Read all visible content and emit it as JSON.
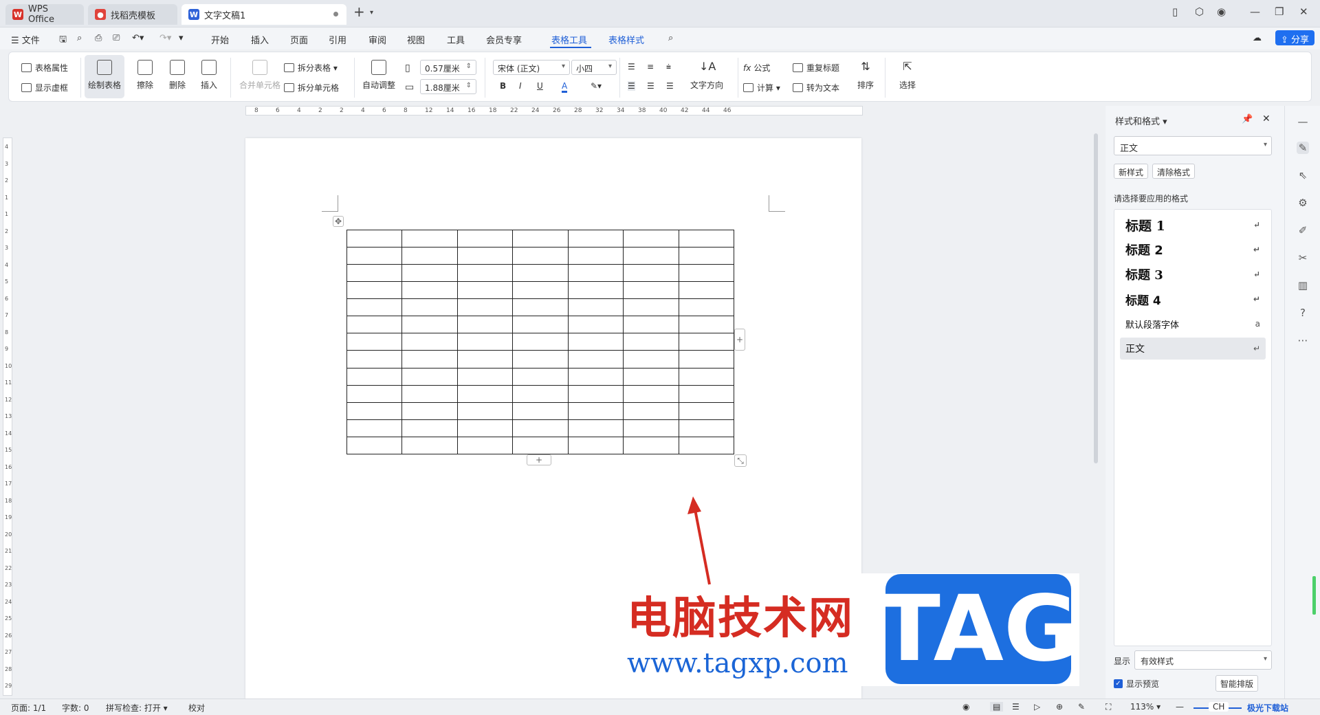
{
  "tabs": [
    {
      "label": "WPS Office",
      "icon": "wps-logo-icon"
    },
    {
      "label": "找稻壳模板",
      "icon": "docer-icon"
    },
    {
      "label": "文字文稿1",
      "icon": "writer-doc-icon"
    }
  ],
  "new_tab": "+",
  "menu": {
    "file": "文件",
    "items": [
      "开始",
      "插入",
      "页面",
      "引用",
      "审阅",
      "视图",
      "工具",
      "会员专享",
      "表格工具",
      "表格样式"
    ],
    "active": "表格工具",
    "share": "分享"
  },
  "ribbon": {
    "table_props": "表格属性",
    "show_gridlines": "显示虚框",
    "draw_table": "绘制表格",
    "erase": "擦除",
    "delete": "删除",
    "insert": "插入",
    "merge_cells": "合并单元格",
    "split_table": "拆分表格",
    "split_cells": "拆分单元格",
    "auto_fit": "自动调整",
    "col_width": "0.57厘米",
    "row_height": "1.88厘米",
    "font_name": "宋体 (正文)",
    "font_size": "小四",
    "bold": "B",
    "italic": "I",
    "underline": "U",
    "font_color": "A",
    "text_direction": "文字方向",
    "formula": "公式",
    "calculate": "计算",
    "repeat_header": "重复标题",
    "to_text": "转为文本",
    "sort": "排序",
    "select": "选择"
  },
  "ruler_ticks": [
    "8",
    "6",
    "4",
    "2",
    "2",
    "4",
    "6",
    "8",
    "12",
    "14",
    "16",
    "18",
    "22",
    "24",
    "26",
    "28",
    "32",
    "34",
    "38",
    "40",
    "42",
    "44",
    "46"
  ],
  "vruler_ticks": [
    "4",
    "3",
    "2",
    "1",
    "1",
    "2",
    "3",
    "4",
    "5",
    "6",
    "7",
    "8",
    "9",
    "10",
    "11",
    "12",
    "13",
    "14",
    "15",
    "16",
    "17",
    "18",
    "19",
    "20",
    "21",
    "22",
    "23",
    "24",
    "25",
    "26",
    "27",
    "28",
    "29"
  ],
  "table": {
    "rows": 13,
    "cols": 7
  },
  "watermark": {
    "cn": "电脑技术网",
    "url": "www.tagxp.com",
    "tag": "TAG"
  },
  "panel": {
    "title": "样式和格式",
    "current_style": "正文",
    "new_style": "新样式",
    "clear_format": "清除格式",
    "hint": "请选择要应用的格式",
    "styles": [
      "标题  1",
      "标题  2",
      "标题  3",
      "标题  4",
      "默认段落字体",
      "正文"
    ],
    "show_label": "显示",
    "show_value": "有效样式",
    "preview_label": "显示预览",
    "smart_layout": "智能排版"
  },
  "status": {
    "page": "页面: 1/1",
    "words": "字数: 0",
    "spell": "拼写检查: 打开",
    "proof": "校对",
    "zoom": "113%",
    "ime": "CH",
    "site_badge": "极光下载站"
  },
  "colors": {
    "accent": "#1f5fd7",
    "watermark_red": "#d52c22",
    "tag_blue": "#1d6fe0"
  }
}
